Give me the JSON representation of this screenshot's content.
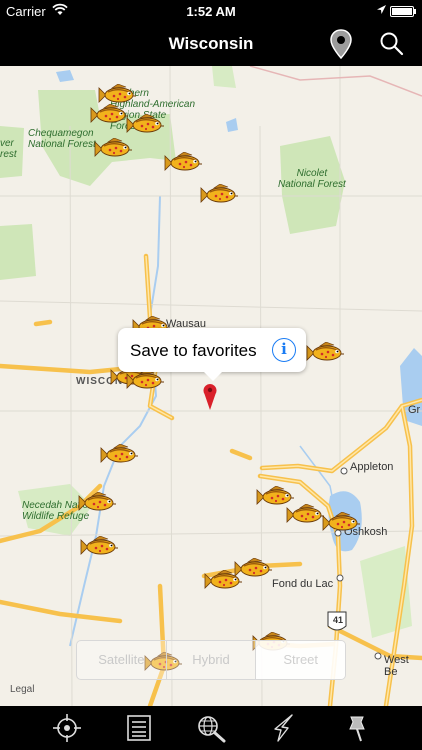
{
  "status_bar": {
    "carrier": "Carrier",
    "time": "1:52 AM"
  },
  "nav": {
    "title": "Wisconsin",
    "icons": [
      "location-pin-icon",
      "search-icon"
    ]
  },
  "map": {
    "park_labels": [
      "Northern\nHighland-American\nLegion State\nForest",
      "Chequamegon\nNational Forest",
      "Nicolet\nNational Forest",
      "Necedah National\nWildlife Refuge",
      "ver\nrest"
    ],
    "city_labels": [
      "Wausau",
      "Appleton",
      "Oshkosh",
      "Fond du Lac",
      "West Be",
      "Gr"
    ],
    "state_label": "WISCONSIN",
    "highway_shield": "41",
    "legal": "Legal"
  },
  "callout": {
    "text": "Save to favorites",
    "info_glyph": "i"
  },
  "map_type_control": {
    "options": [
      "Satellite",
      "Hybrid",
      "Street"
    ],
    "selected": "Street"
  },
  "tab_bar": {
    "icons": [
      "crosshair-locate-icon",
      "list-icon",
      "globe-search-icon",
      "lightning-weather-icon",
      "pushpin-icon"
    ]
  },
  "colors": {
    "bar_background": "#000000",
    "bar_foreground": "#ffffff",
    "map_land": "#f3f0e8",
    "park_green": "#cfe6b8",
    "highway": "#f7c14c",
    "water": "#a9cdf0",
    "info_blue": "#1a7cf4",
    "pin_red": "#d9202a"
  }
}
